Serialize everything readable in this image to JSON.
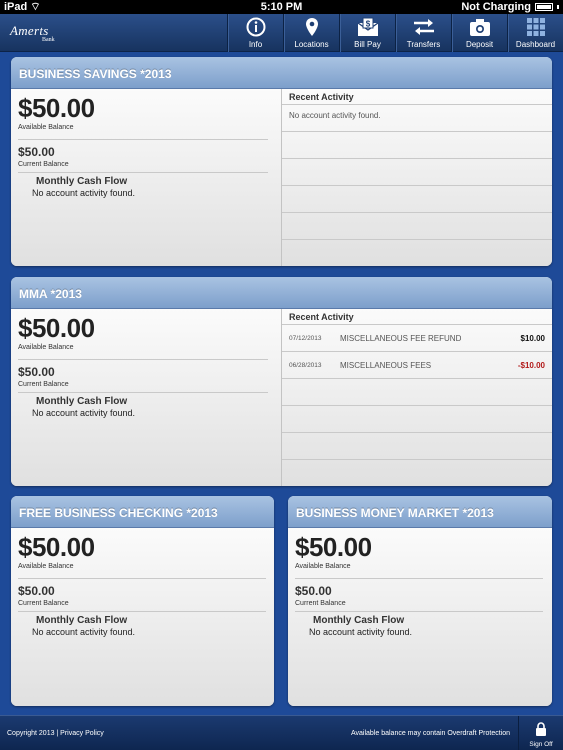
{
  "status_bar": {
    "device": "iPad",
    "time": "5:10 PM",
    "charging": "Not Charging"
  },
  "nav": {
    "logo_name": "Amerts",
    "logo_sub": "Bank",
    "buttons": [
      {
        "label": "Info",
        "icon": "info-icon"
      },
      {
        "label": "Locations",
        "icon": "location-pin-icon"
      },
      {
        "label": "Bill Pay",
        "icon": "bill-pay-envelope-icon"
      },
      {
        "label": "Transfers",
        "icon": "transfer-arrows-icon"
      },
      {
        "label": "Deposit",
        "icon": "camera-icon"
      },
      {
        "label": "Dashboard",
        "icon": "grid-icon"
      }
    ]
  },
  "accounts": [
    {
      "title": "BUSINESS SAVINGS *2013",
      "available_balance": "$50.00",
      "available_label": "Available Balance",
      "current_balance": "$50.00",
      "current_label": "Current Balance",
      "cash_flow_title": "Monthly Cash Flow",
      "cash_flow_empty": "No account activity found.",
      "recent_activity_title": "Recent Activity",
      "recent_empty": "No account activity found.",
      "transactions": []
    },
    {
      "title": "MMA *2013",
      "available_balance": "$50.00",
      "available_label": "Available Balance",
      "current_balance": "$50.00",
      "current_label": "Current Balance",
      "cash_flow_title": "Monthly Cash Flow",
      "cash_flow_empty": "No account activity found.",
      "recent_activity_title": "Recent Activity",
      "transactions": [
        {
          "date": "07/12/2013",
          "description": "MISCELLANEOUS FEE REFUND",
          "amount": "$10.00"
        },
        {
          "date": "06/28/2013",
          "description": "MISCELLANEOUS FEES",
          "amount": "-$10.00"
        }
      ]
    },
    {
      "title": "FREE BUSINESS CHECKING *2013",
      "available_balance": "$50.00",
      "available_label": "Available Balance",
      "current_balance": "$50.00",
      "current_label": "Current Balance",
      "cash_flow_title": "Monthly Cash Flow",
      "cash_flow_empty": "No account activity found."
    },
    {
      "title": "BUSINESS MONEY MARKET *2013",
      "available_balance": "$50.00",
      "available_label": "Available Balance",
      "current_balance": "$50.00",
      "current_label": "Current Balance",
      "cash_flow_title": "Monthly Cash Flow",
      "cash_flow_empty": "No account activity found."
    }
  ],
  "footer": {
    "copyright": "Copyright 2013 | Privacy Policy",
    "note": "Available balance may contain Overdraft Protection",
    "sign_off": "Sign Off"
  },
  "colors": {
    "negative": "#b21a1a",
    "header_blue": "#7d9fcb",
    "background": "#1e4a98"
  }
}
